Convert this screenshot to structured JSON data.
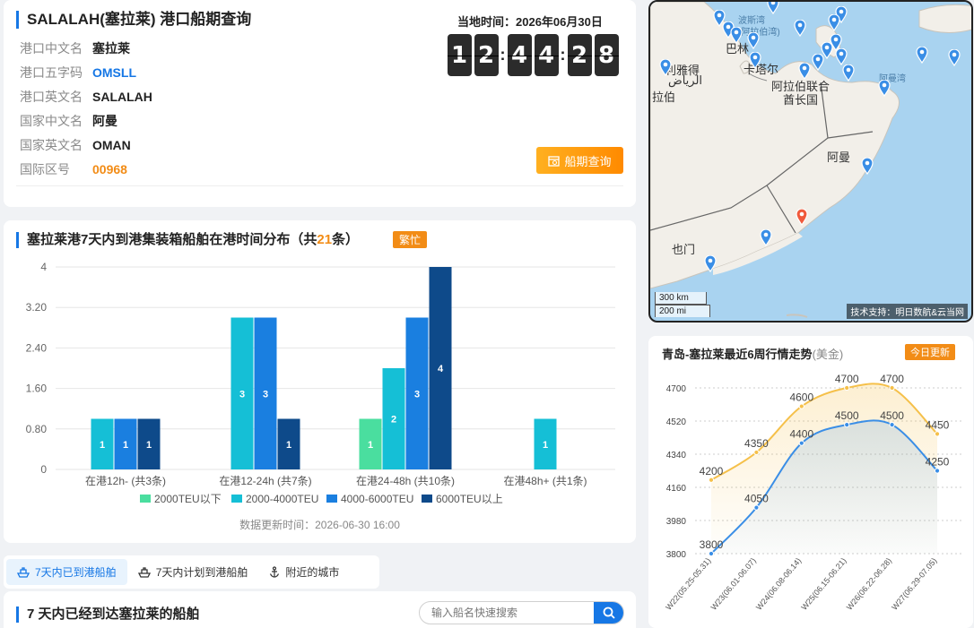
{
  "port": {
    "title": "SALALAH(塞拉莱) 港口船期查询",
    "rows": [
      {
        "label": "港口中文名",
        "value": "塞拉莱"
      },
      {
        "label": "港口五字码",
        "value": "OMSLL"
      },
      {
        "label": "港口英文名",
        "value": "SALALAH"
      },
      {
        "label": "国家中文名",
        "value": "阿曼"
      },
      {
        "label": "国家英文名",
        "value": "OMAN"
      },
      {
        "label": "国际区号",
        "value": "00968"
      }
    ],
    "time_label": "当地时间：2026年06月30日",
    "clock_digits": [
      "1",
      "2",
      "4",
      "4",
      "2",
      "8"
    ],
    "clock_sep": ":",
    "schedule_button": "船期查询"
  },
  "map": {
    "labels": {
      "gulf": "波斯湾",
      "gulf2": "(阿拉伯湾)",
      "bahrain": "巴林",
      "qatar": "卡塔尔",
      "riyadh": "利雅得",
      "riyadh_ar": "الرياض",
      "saudi": "拉伯",
      "uae1": "阿拉伯联合",
      "uae2": "酋长国",
      "oman": "阿曼",
      "yemen": "也门",
      "gulf_oman": "阿曼湾"
    },
    "scale_km": "300 km",
    "scale_mi": "200 mi",
    "credit": "技术支持：明日数航&云当网"
  },
  "distribution": {
    "title_prefix": "塞拉莱港7天内到港集装箱船舶在港时间分布（共",
    "count": "21",
    "title_suffix": "条）",
    "badge": "繁忙",
    "updated": "数据更新时间：2026-06-30 16:00"
  },
  "chart_data": [
    {
      "type": "bar",
      "categories": [
        "在港12h- (共3条)",
        "在港12-24h (共7条)",
        "在港24-48h (共10条)",
        "在港48h+ (共1条)"
      ],
      "series": [
        {
          "name": "2000TEU以下",
          "color": "#4ade9f",
          "values": [
            0,
            0,
            1,
            0
          ]
        },
        {
          "name": "2000-4000TEU",
          "color": "#15bfd6",
          "values": [
            1,
            3,
            2,
            1
          ]
        },
        {
          "name": "4000-6000TEU",
          "color": "#1a7fe0",
          "values": [
            1,
            3,
            3,
            0
          ]
        },
        {
          "name": "6000TEU以上",
          "color": "#0e4a8a",
          "values": [
            1,
            1,
            4,
            0
          ]
        }
      ],
      "yticks": [
        "0",
        "0.80",
        "1.60",
        "2.40",
        "3.20",
        "4"
      ],
      "ylim": [
        0,
        4
      ],
      "legend": "bottom"
    },
    {
      "type": "line",
      "title": "青岛-塞拉莱最近6周行情走势",
      "unit": "(美金)",
      "badge": "今日更新",
      "categories": [
        "W22(05.25-05.31)",
        "W23(06.01-06.07)",
        "W24(06.08-06.14)",
        "W25(06.15-06.21)",
        "W26(06.22-06.28)",
        "W27(06.29-07.05)"
      ],
      "series": [
        {
          "name": "",
          "color": "#f5c04a",
          "values": [
            4200,
            4350,
            4600,
            4700,
            4700,
            4450
          ]
        },
        {
          "name": "",
          "color": "#3a8ee6",
          "values": [
            3800,
            4050,
            4400,
            4500,
            4500,
            4250
          ]
        }
      ],
      "yticks": [
        "3800",
        "3980",
        "4160",
        "4340",
        "4520",
        "4700"
      ],
      "ylim": [
        3800,
        4700
      ]
    }
  ],
  "tabs": [
    {
      "label": "7天内已到港船舶",
      "active": true
    },
    {
      "label": "7天内计划到港船舶",
      "active": false
    },
    {
      "label": "附近的城市",
      "active": false
    }
  ],
  "arrived": {
    "title": "7 天内已经到达塞拉莱的船舶",
    "search_placeholder": "输入船名快速搜索"
  }
}
